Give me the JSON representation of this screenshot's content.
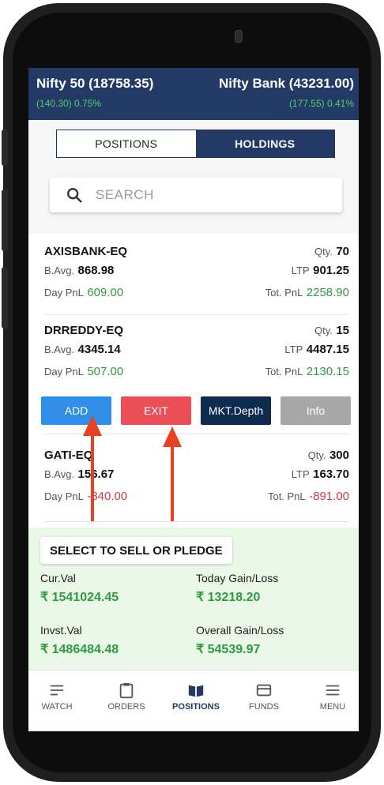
{
  "indices": [
    {
      "name": "Nifty 50 (18758.35)",
      "change": "(140.30) 0.75%"
    },
    {
      "name": "Nifty Bank (43231.00)",
      "change": "(177.55) 0.41%"
    }
  ],
  "tabs": [
    {
      "label": "POSITIONS",
      "active": false
    },
    {
      "label": "HOLDINGS",
      "active": true
    }
  ],
  "search": {
    "placeholder": "SEARCH"
  },
  "holdings": [
    {
      "symbol": "AXISBANK-EQ",
      "qty_label": "Qty.",
      "qty": "70",
      "bavg_label": "B.Avg.",
      "bavg": "868.98",
      "ltp_label": "LTP",
      "ltp": "901.25",
      "daypnl_label": "Day PnL",
      "daypnl": "609.00",
      "totpnl_label": "Tot. PnL",
      "totpnl": "2258.90"
    },
    {
      "symbol": "DRREDDY-EQ",
      "qty_label": "Qty.",
      "qty": "15",
      "bavg_label": "B.Avg.",
      "bavg": "4345.14",
      "ltp_label": "LTP",
      "ltp": "4487.15",
      "daypnl_label": "Day PnL",
      "daypnl": "507.00",
      "totpnl_label": "Tot. PnL",
      "totpnl": "2130.15"
    },
    {
      "symbol": "GATI-EQ",
      "qty_label": "Qty.",
      "qty": "300",
      "bavg_label": "B.Avg.",
      "bavg": "156.67",
      "ltp_label": "LTP",
      "ltp": "163.70",
      "daypnl_label": "Day PnL",
      "daypnl": "-840.00",
      "totpnl_label": "Tot. PnL",
      "totpnl": "-891.00"
    }
  ],
  "actions": {
    "add": "ADD",
    "exit": "EXIT",
    "depth": "MKT.Depth",
    "info": "Info"
  },
  "summary": {
    "sell_pledge": "SELECT TO SELL OR PLEDGE",
    "cur_val_label": "Cur.Val",
    "cur_val": "₹ 1541024.45",
    "today_label": "Today Gain/Loss",
    "today_val": "₹ 13218.20",
    "invst_label": "Invst.Val",
    "invst_val": "₹ 1486484.48",
    "overall_label": "Overall Gain/Loss",
    "overall_val": "₹ 54539.97"
  },
  "nav": [
    {
      "label": "WATCH",
      "icon": "watch-icon"
    },
    {
      "label": "ORDERS",
      "icon": "orders-icon"
    },
    {
      "label": "POSITIONS",
      "icon": "positions-icon",
      "active": true
    },
    {
      "label": "FUNDS",
      "icon": "funds-icon"
    },
    {
      "label": "MENU",
      "icon": "menu-icon"
    }
  ],
  "colors": {
    "header": "#233a66",
    "positive": "#2f9a41",
    "negative": "#d3363e",
    "add": "#2f8fe8",
    "exit": "#ec4e58",
    "annotation_arrow": "#e8411f"
  }
}
